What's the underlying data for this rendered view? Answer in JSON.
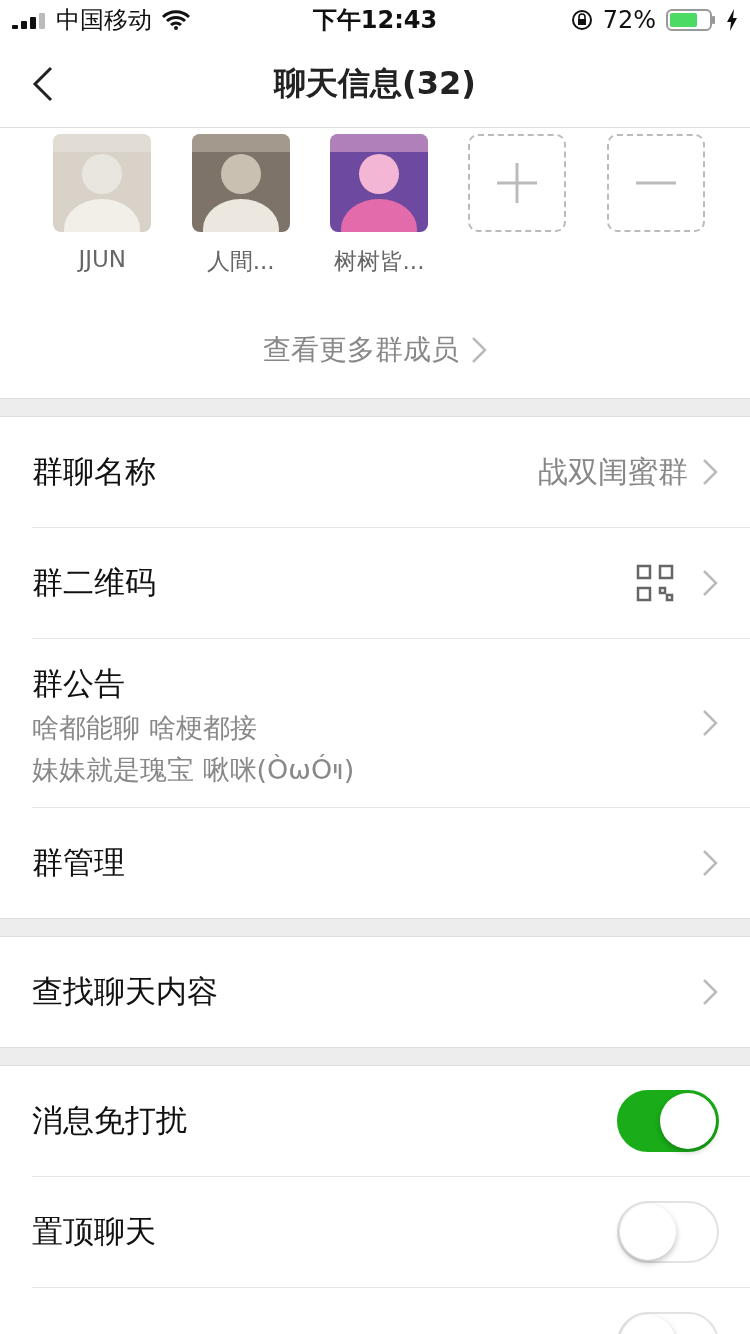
{
  "status_bar": {
    "carrier": "中国移动",
    "time": "下午12:43",
    "battery": "72%"
  },
  "nav": {
    "title": "聊天信息(32)"
  },
  "members": [
    {
      "name": "JJUN",
      "kind": "picture"
    },
    {
      "name": "人間...",
      "kind": "picture"
    },
    {
      "name": "树树皆...",
      "kind": "picture"
    },
    {
      "kind": "add"
    },
    {
      "kind": "remove"
    }
  ],
  "more_members": "查看更多群成员",
  "sections": [
    [
      {
        "kind": "value",
        "label": "群聊名称",
        "value": "战双闺蜜群"
      },
      {
        "kind": "qr",
        "label": "群二维码"
      },
      {
        "kind": "notice",
        "label": "群公告",
        "lines": [
          "啥都能聊 啥梗都接",
          "妹妹就是瑰宝 啾咪(ÒωÓױ)"
        ]
      },
      {
        "kind": "link",
        "label": "群管理"
      }
    ],
    [
      {
        "kind": "link",
        "label": "查找聊天内容"
      }
    ],
    [
      {
        "kind": "toggle",
        "label": "消息免打扰",
        "on": true
      },
      {
        "kind": "toggle",
        "label": "置顶聊天",
        "on": false
      },
      {
        "kind": "toggle",
        "on": false
      }
    ]
  ]
}
